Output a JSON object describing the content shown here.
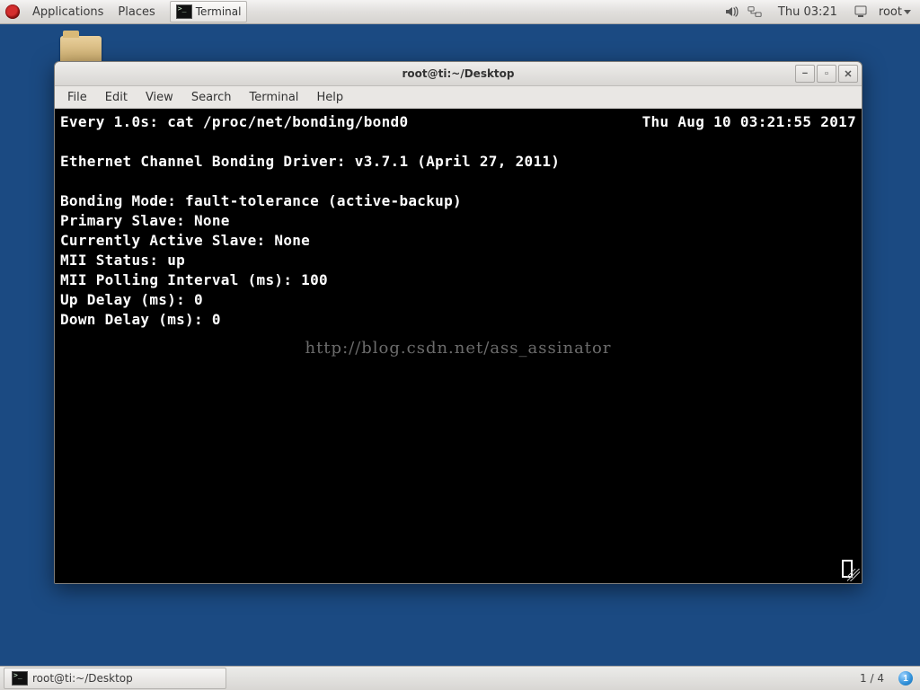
{
  "topbar": {
    "applications": "Applications",
    "places": "Places",
    "task_terminal": "Terminal",
    "clock": "Thu 03:21",
    "user": "root"
  },
  "desktop": {
    "folder_label": ""
  },
  "window": {
    "title": "root@ti:~/Desktop",
    "menus": [
      "File",
      "Edit",
      "View",
      "Search",
      "Terminal",
      "Help"
    ]
  },
  "terminal": {
    "header_left": "Every 1.0s: cat /proc/net/bonding/bond0",
    "header_right": "Thu Aug 10 03:21:55 2017",
    "lines": [
      "",
      "Ethernet Channel Bonding Driver: v3.7.1 (April 27, 2011)",
      "",
      "Bonding Mode: fault-tolerance (active-backup)",
      "Primary Slave: None",
      "Currently Active Slave: None",
      "MII Status: up",
      "MII Polling Interval (ms): 100",
      "Up Delay (ms): 0",
      "Down Delay (ms): 0"
    ],
    "watermark": "http://blog.csdn.net/ass_assinator"
  },
  "bottombar": {
    "task": "root@ti:~/Desktop",
    "workspace": "1 / 4",
    "badge": "1"
  }
}
